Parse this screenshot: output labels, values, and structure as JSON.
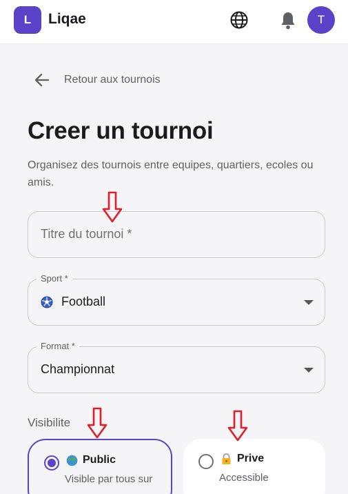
{
  "app": {
    "logo_letter": "L",
    "name": "Liqae",
    "avatar_letter": "T"
  },
  "nav": {
    "back_label": "Retour aux tournois"
  },
  "page": {
    "title": "Creer un tournoi",
    "subtitle": "Organisez des tournois entre equipes, quartiers, ecoles ou amis."
  },
  "form": {
    "title_placeholder": "Titre du tournoi *",
    "sport": {
      "label": "Sport *",
      "value": "Football",
      "icon": "soccer-ball-icon"
    },
    "format": {
      "label": "Format *",
      "value": "Championnat"
    },
    "visibility": {
      "label": "Visibilite",
      "options": [
        {
          "label": "Public",
          "icon": "globe-emoji-icon",
          "description": "Visible par tous sur",
          "selected": true
        },
        {
          "label": "Prive",
          "icon": "lock-icon",
          "description": "Accessible",
          "selected": false
        }
      ]
    }
  },
  "colors": {
    "accent": "#5b43c9",
    "annotation": "#e11d2a"
  }
}
